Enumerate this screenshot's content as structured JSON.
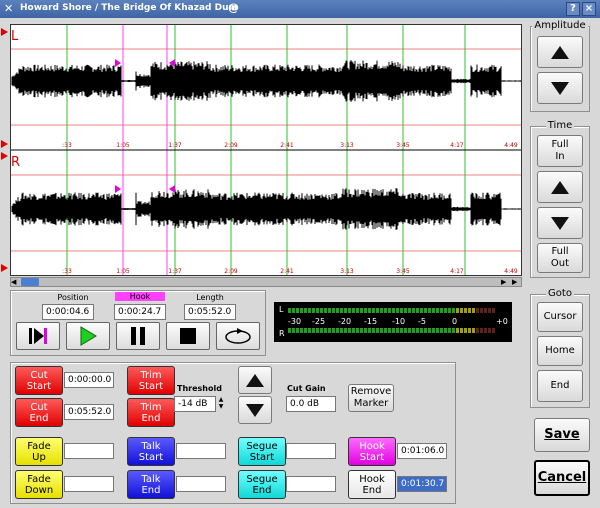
{
  "window": {
    "title": "Howard Shore / The Bridge Of Khazad Dum",
    "help": "?",
    "minimize": "-",
    "close": "×"
  },
  "wave": {
    "left_label": "L",
    "right_label": "R",
    "time_labels": [
      ":33",
      "1:05",
      "1:37",
      "2:09",
      "2:41",
      "3:13",
      "3:45",
      "4:17",
      "4:49"
    ]
  },
  "readouts": {
    "position_label": "Position",
    "position_value": "0:00:04.6",
    "hook_label": "Hook",
    "hook_value": "0:00:24.7",
    "length_label": "Length",
    "length_value": "0:05:52.0"
  },
  "meter": {
    "l": "L",
    "r": "R",
    "scale": [
      "-30",
      "-25",
      "-20",
      "-15",
      "-10",
      "-5",
      "0",
      "+0"
    ]
  },
  "amplitude": {
    "title": "Amplitude"
  },
  "time_panel": {
    "title": "Time",
    "full_in": "Full\nIn",
    "full_out": "Full\nOut"
  },
  "goto": {
    "title": "Goto",
    "cursor": "Cursor",
    "home": "Home",
    "end": "End"
  },
  "actions": {
    "save": "Save",
    "cancel": "Cancel"
  },
  "edit": {
    "cut_start": "Cut\nStart",
    "cut_start_value": "0:00:00.0",
    "cut_end": "Cut\nEnd",
    "cut_end_value": "0:05:52.0",
    "trim_start": "Trim\nStart",
    "trim_end": "Trim\nEnd",
    "threshold_label": "Threshold",
    "threshold_value": "-14 dB",
    "cut_gain_label": "Cut Gain",
    "cut_gain_value": "0.0 dB",
    "remove_marker": "Remove\nMarker",
    "fade_up": "Fade\nUp",
    "fade_down": "Fade\nDown",
    "talk_start": "Talk\nStart",
    "talk_end": "Talk\nEnd",
    "segue_start": "Segue\nStart",
    "segue_end": "Segue\nEnd",
    "hook_start": "Hook\nStart",
    "hook_start_value": "0:01:06.0",
    "hook_end": "Hook\nEnd",
    "hook_end_value": "0:01:30.7"
  }
}
